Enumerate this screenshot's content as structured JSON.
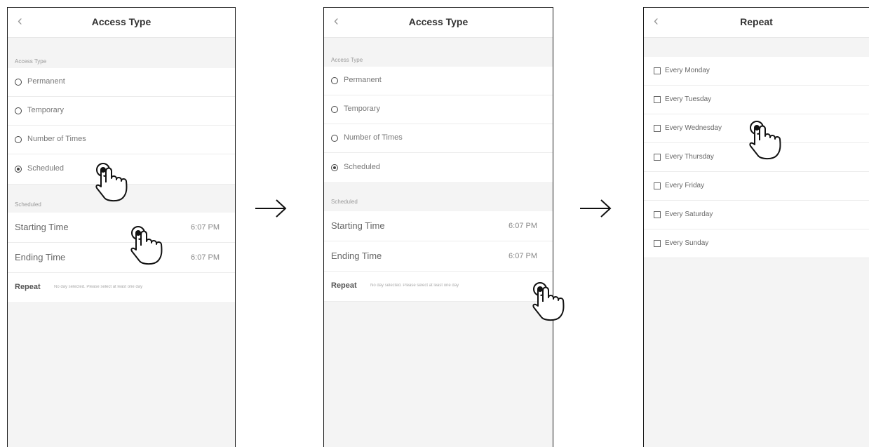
{
  "screen1": {
    "nav": {
      "back_icon": "chevron-left-icon",
      "title": "Access Type"
    },
    "access_type_label": "Access Type",
    "options": [
      {
        "label": "Permanent",
        "selected": false
      },
      {
        "label": "Temporary",
        "selected": false
      },
      {
        "label": "Number of Times",
        "selected": false
      },
      {
        "label": "Scheduled",
        "selected": true
      }
    ],
    "scheduled_label": "Scheduled",
    "starting_time": {
      "label": "Starting Time",
      "value": "6:07 PM"
    },
    "ending_time": {
      "label": "Ending Time",
      "value": "6:07 PM"
    },
    "repeat": {
      "label": "Repeat",
      "hint": "No day selected. Please select at least one day"
    }
  },
  "screen2": {
    "nav": {
      "back_icon": "chevron-left-icon",
      "title": "Access Type"
    },
    "access_type_label": "Access Type",
    "options": [
      {
        "label": "Permanent",
        "selected": false
      },
      {
        "label": "Temporary",
        "selected": false
      },
      {
        "label": "Number of Times",
        "selected": false
      },
      {
        "label": "Scheduled",
        "selected": true
      }
    ],
    "scheduled_label": "Scheduled",
    "starting_time": {
      "label": "Starting Time",
      "value": "6:07 PM"
    },
    "ending_time": {
      "label": "Ending Time",
      "value": "6:07 PM"
    },
    "repeat": {
      "label": "Repeat",
      "hint": "No day selected. Please select at least one day"
    }
  },
  "screen3": {
    "nav": {
      "back_icon": "chevron-left-icon",
      "title": "Repeat"
    },
    "days": [
      {
        "label": "Every Monday",
        "checked": false
      },
      {
        "label": "Every Tuesday",
        "checked": false
      },
      {
        "label": "Every Wednesday",
        "checked": false
      },
      {
        "label": "Every Thursday",
        "checked": false
      },
      {
        "label": "Every Friday",
        "checked": false
      },
      {
        "label": "Every Saturday",
        "checked": false
      },
      {
        "label": "Every Sunday",
        "checked": false
      }
    ]
  },
  "icons": {
    "arrow": "arrow-right-icon",
    "pointer": "tap-hand-icon"
  },
  "colors": {
    "frame_border": "#1a1a1a",
    "background": "#f4f4f4",
    "row": "#ffffff"
  }
}
